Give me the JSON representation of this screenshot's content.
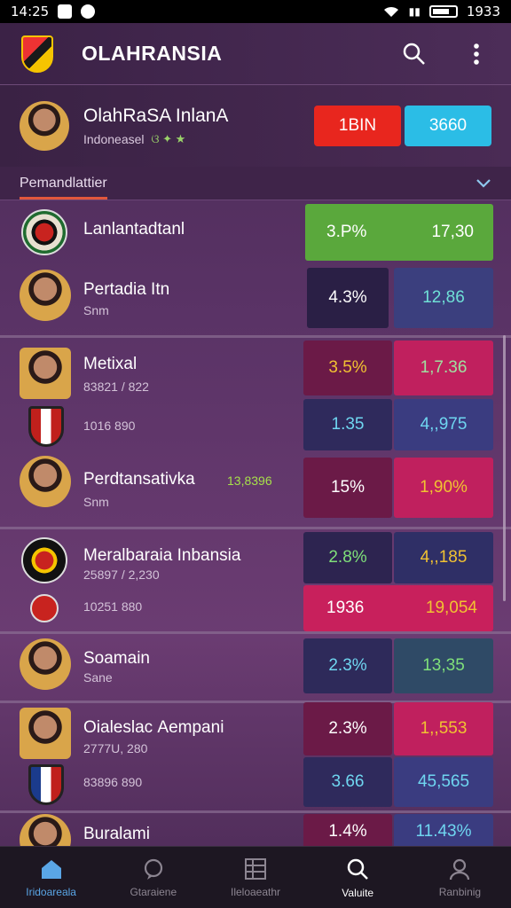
{
  "status": {
    "time": "14:25",
    "right_time": "1933"
  },
  "app": {
    "title": "OLAHRANSIA"
  },
  "hero": {
    "name": "OlahRaSA InlanA",
    "sub": "Indoneasel",
    "badges": "ଓ ✦ ★",
    "btn_red": "1BIN",
    "btn_cyan": "3660"
  },
  "section": {
    "title": "Pemandlattier"
  },
  "rows": [
    {
      "name": "Lanlantadtanl",
      "v1": "3.P%",
      "v2": "17,30"
    },
    {
      "name": "Pertadia Itn",
      "sub": "Snm",
      "v1": "4.3%",
      "v2": "12,86"
    },
    {
      "name": "Metixal",
      "sub": "83821 / 822",
      "sub2": "1016 890",
      "v1": "3.5%",
      "v2": "1,7.36",
      "v3": "1.35",
      "v4": "4,,975"
    },
    {
      "name": "Perdtansativka",
      "sub": "Snm",
      "extra": "13,8396",
      "v1": "15%",
      "v2": "1,90%"
    },
    {
      "name": "Meralbaraia Inbansia",
      "sub": "25897 / 2,230",
      "sub2": "10251 880",
      "v1": "2.8%",
      "v2": "4,,185",
      "v3": "1936",
      "v4": "19,054"
    },
    {
      "name": "Soamain",
      "sub": "Sane",
      "v1": "2.3%",
      "v2": "13,35"
    },
    {
      "name": "Oialeslaс Aempani",
      "sub": "2777U, 280",
      "sub2": "83896 890",
      "v1": "2.3%",
      "v2": "1,,553",
      "v3": "3.66",
      "v4": "45,565"
    },
    {
      "name": "Buralami",
      "v1": "1.4%",
      "v2": "11.43%"
    }
  ],
  "nav": [
    {
      "label": "Iridoareala",
      "icon": "home-icon"
    },
    {
      "label": "Gtaraiene",
      "icon": "chat-icon"
    },
    {
      "label": "Ileloaeathr",
      "icon": "grid-icon"
    },
    {
      "label": "Valuite",
      "icon": "search-icon"
    },
    {
      "label": "Ranbinig",
      "icon": "profile-icon"
    }
  ],
  "colors": {
    "accent": "#e2573c",
    "active_tab": "#5aa6e6"
  }
}
